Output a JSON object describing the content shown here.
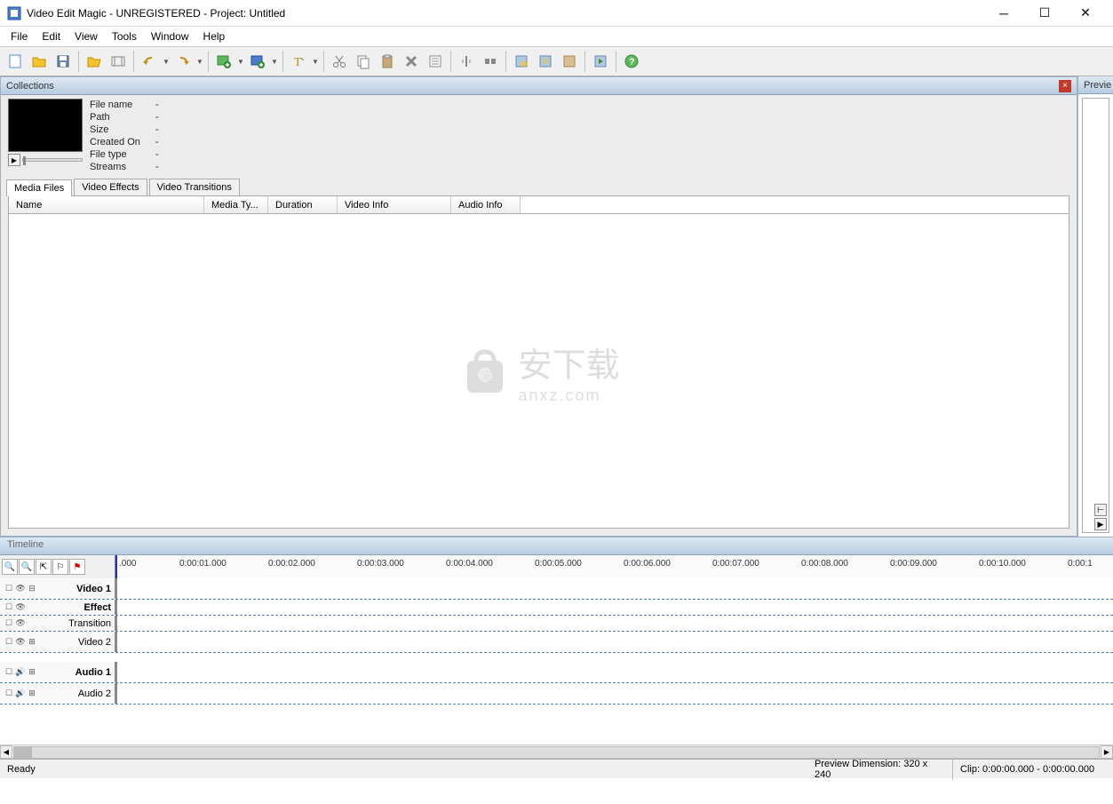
{
  "window": {
    "title": "Video Edit Magic - UNREGISTERED - Project: Untitled"
  },
  "menu": {
    "file": "File",
    "edit": "Edit",
    "view": "View",
    "tools": "Tools",
    "window": "Window",
    "help": "Help"
  },
  "collections": {
    "title": "Collections",
    "info": {
      "filename_l": "File name",
      "filename_v": "-",
      "path_l": "Path",
      "path_v": "-",
      "size_l": "Size",
      "size_v": "-",
      "created_l": "Created On",
      "created_v": "-",
      "filetype_l": "File type",
      "filetype_v": "-",
      "streams_l": "Streams",
      "streams_v": "-"
    },
    "tabs": {
      "media": "Media Files",
      "effects": "Video Effects",
      "transitions": "Video Transitions"
    },
    "columns": {
      "name": "Name",
      "media": "Media Ty...",
      "duration": "Duration",
      "vinfo": "Video Info",
      "ainfo": "Audio Info"
    }
  },
  "preview": {
    "title": "Previe"
  },
  "timeline": {
    "title": "Timeline",
    "ticks": {
      "t0": ".000",
      "t1": "0:00:01.000",
      "t2": "0:00:02.000",
      "t3": "0:00:03.000",
      "t4": "0:00:04.000",
      "t5": "0:00:05.000",
      "t6": "0:00:06.000",
      "t7": "0:00:07.000",
      "t8": "0:00:08.000",
      "t9": "0:00:09.000",
      "t10": "0:00:10.000",
      "t11": "0:00:1"
    },
    "tracks": {
      "video1": "Video 1",
      "effect": "Effect",
      "transition": "Transition",
      "video2": "Video 2",
      "audio1": "Audio 1",
      "audio2": "Audio 2"
    }
  },
  "status": {
    "ready": "Ready",
    "preview": "Preview Dimension: 320 x 240",
    "clip": "Clip: 0:00:00.000 - 0:00:00.000"
  },
  "watermark": {
    "text": "安下载",
    "sub": "anxz.com"
  }
}
